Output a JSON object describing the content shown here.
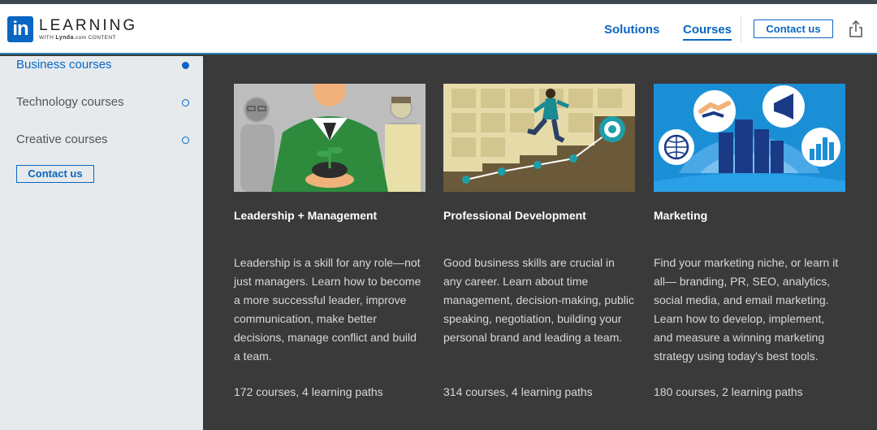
{
  "brand": {
    "logo_mark": "in",
    "logo_word": "LEARNING",
    "logo_sub_prefix": "WITH ",
    "logo_sub_brand": "Lynda",
    "logo_sub_suffix": ".com CONTENT"
  },
  "nav": {
    "solutions": "Solutions",
    "courses": "Courses",
    "contact": "Contact us",
    "share_icon": "share-icon"
  },
  "sidebar": {
    "items": [
      {
        "label": "Business courses",
        "active": true
      },
      {
        "label": "Technology courses",
        "active": false
      },
      {
        "label": "Creative courses",
        "active": false
      }
    ],
    "contact": "Contact us"
  },
  "cards": [
    {
      "title": "Leadership + Management",
      "description": "Leadership is a skill for any role—not just managers. Learn how to become a more successful leader, improve communication, make better decisions, manage conflict and build a team.",
      "meta": "172 courses, 4 learning paths"
    },
    {
      "title": "Professional Development",
      "description": "Good business skills are crucial in any career. Learn about time management, decision-making, public speaking, negotiation, building your personal brand and leading a team.",
      "meta": "314 courses, 4 learning paths"
    },
    {
      "title": "Marketing",
      "description": "Find your marketing niche, or learn it all— branding, PR, SEO, analytics, social media, and email marketing. Learn how to develop, implement, and measure a winning marketing strategy using today's best tools.",
      "meta": "180 courses, 2 learning paths"
    }
  ],
  "colors": {
    "accent": "#0a66c2",
    "content_bg": "#3a3a3a",
    "sidebar_bg": "#e6eaed"
  }
}
